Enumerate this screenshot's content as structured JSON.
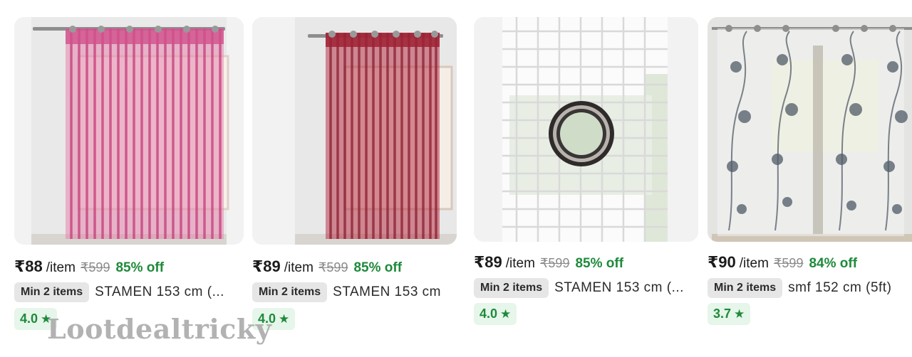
{
  "products": [
    {
      "image_label": "pink striped sheer curtain",
      "price": "₹88",
      "unit": "/item",
      "mrp": "₹599",
      "discount": "85% off",
      "min_qty": "Min 2 items",
      "title": "STAMEN 153 cm (...",
      "rating": "4.0"
    },
    {
      "image_label": "maroon striped sheer curtain",
      "price": "₹89",
      "unit": "/item",
      "mrp": "₹599",
      "discount": "85% off",
      "min_qty": "Min 2 items",
      "title": "STAMEN 153 cm",
      "rating": "4.0"
    },
    {
      "image_label": "white net curtain with eyelet",
      "price": "₹89",
      "unit": "/item",
      "mrp": "₹599",
      "discount": "85% off",
      "min_qty": "Min 2 items",
      "title": "STAMEN 153 cm (...",
      "rating": "4.0"
    },
    {
      "image_label": "white floral sheer curtains",
      "price": "₹90",
      "unit": "/item",
      "mrp": "₹599",
      "discount": "84% off",
      "min_qty": "Min 2 items",
      "title": "smf 152 cm (5ft)",
      "rating": "3.7"
    }
  ],
  "watermark": "Lootdealtricky",
  "icons": {
    "rating": "star-icon"
  },
  "colors": {
    "discount": "#1e8a3a",
    "rating_bg": "#e6f6ea",
    "badge_bg": "#e6e6e6"
  }
}
